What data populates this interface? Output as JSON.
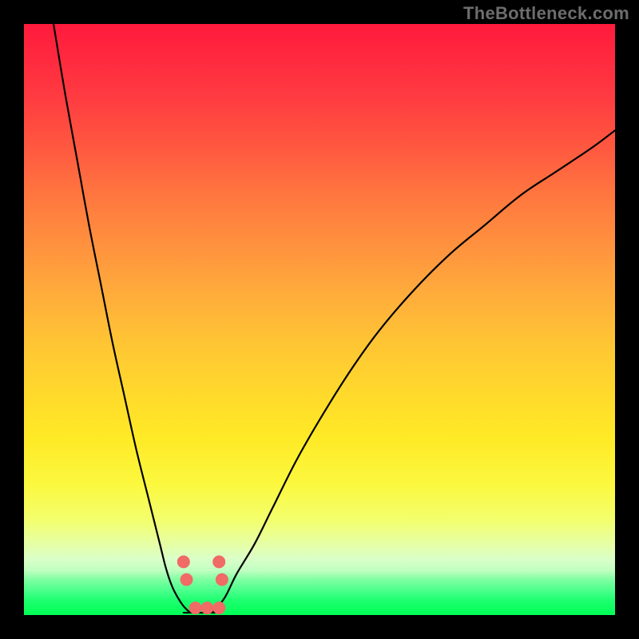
{
  "watermark": "TheBottleneck.com",
  "colors": {
    "pageBg": "#000000",
    "gradientTop": "#ff1a3d",
    "gradientMid": "#ffd82c",
    "gradientBottom": "#00ff55",
    "curveStroke": "#000000",
    "marker": "#f06a66",
    "watermarkText": "#6d6d6d"
  },
  "chart_data": {
    "type": "line",
    "title": "",
    "xlabel": "",
    "ylabel": "",
    "xlim": [
      0,
      100
    ],
    "ylim": [
      0,
      100
    ],
    "series": [
      {
        "name": "left-curve",
        "x": [
          5,
          7,
          9,
          11,
          13,
          15,
          17,
          19,
          21,
          23,
          24,
          25,
          26,
          27,
          28
        ],
        "y": [
          100,
          88,
          77,
          66,
          56,
          46,
          37,
          28,
          20,
          12,
          8,
          5,
          3,
          1.5,
          0.5
        ]
      },
      {
        "name": "right-curve",
        "x": [
          32,
          34,
          36,
          39,
          42,
          46,
          50,
          55,
          60,
          66,
          72,
          78,
          84,
          90,
          96,
          100
        ],
        "y": [
          0.5,
          3,
          7,
          12,
          18,
          26,
          33,
          41,
          48,
          55,
          61,
          66,
          71,
          75,
          79,
          82
        ]
      }
    ],
    "floor": {
      "name": "flat-minimum",
      "x": [
        27,
        33
      ],
      "y": [
        0.4,
        0.4
      ]
    },
    "markers": [
      {
        "name": "left-join-top",
        "cx": 27,
        "cy": 9
      },
      {
        "name": "left-join-bottom",
        "cx": 27.5,
        "cy": 6
      },
      {
        "name": "right-join-top",
        "cx": 33,
        "cy": 9
      },
      {
        "name": "right-join-bottom",
        "cx": 33.5,
        "cy": 6
      },
      {
        "name": "floor-left",
        "cx": 29,
        "cy": 1.2
      },
      {
        "name": "floor-mid",
        "cx": 31,
        "cy": 1.2
      },
      {
        "name": "floor-right",
        "cx": 33,
        "cy": 1.2
      }
    ]
  }
}
